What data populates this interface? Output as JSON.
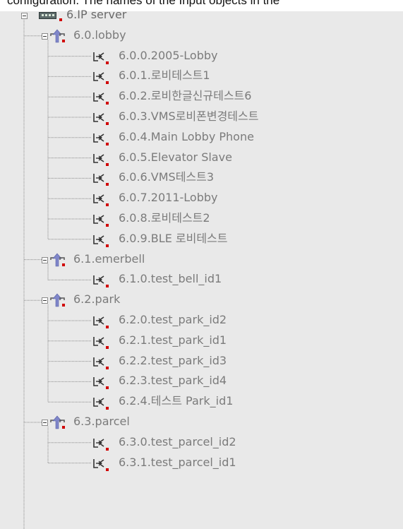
{
  "header_fragment": "configuration. The names of the Input objects in the",
  "tree": {
    "root": {
      "label": "6.IP server",
      "icon": "ip-server-icon"
    },
    "groups": [
      {
        "label": "6.0.lobby",
        "icon": "group-arrow-icon",
        "children": [
          "6.0.0.2005-Lobby",
          "6.0.1.로비테스트1",
          "6.0.2.로비한글신규테스트6",
          "6.0.3.VMS로비폰변경테스트",
          "6.0.4.Main Lobby Phone",
          "6.0.5.Elevator Slave",
          "6.0.6.VMS테스트3",
          "6.0.7.2011-Lobby",
          "6.0.8.로비테스트2",
          "6.0.9.BLE 로비테스트"
        ]
      },
      {
        "label": "6.1.emerbell",
        "icon": "group-arrow-icon",
        "children": [
          "6.1.0.test_bell_id1"
        ]
      },
      {
        "label": "6.2.park",
        "icon": "group-arrow-icon",
        "children": [
          "6.2.0.test_park_id2",
          "6.2.1.test_park_id1",
          "6.2.2.test_park_id3",
          "6.2.3.test_park_id4",
          "6.2.4.테스트 Park_id1"
        ]
      },
      {
        "label": "6.3.parcel",
        "icon": "group-arrow-icon",
        "children": [
          "6.3.0.test_parcel_id2",
          "6.3.1.test_parcel_id1"
        ]
      }
    ],
    "item_icon": "input-object-icon",
    "colors": {
      "text": "#7b7b7b",
      "marker": "#d00000",
      "arrow": "#7f86c9"
    }
  }
}
